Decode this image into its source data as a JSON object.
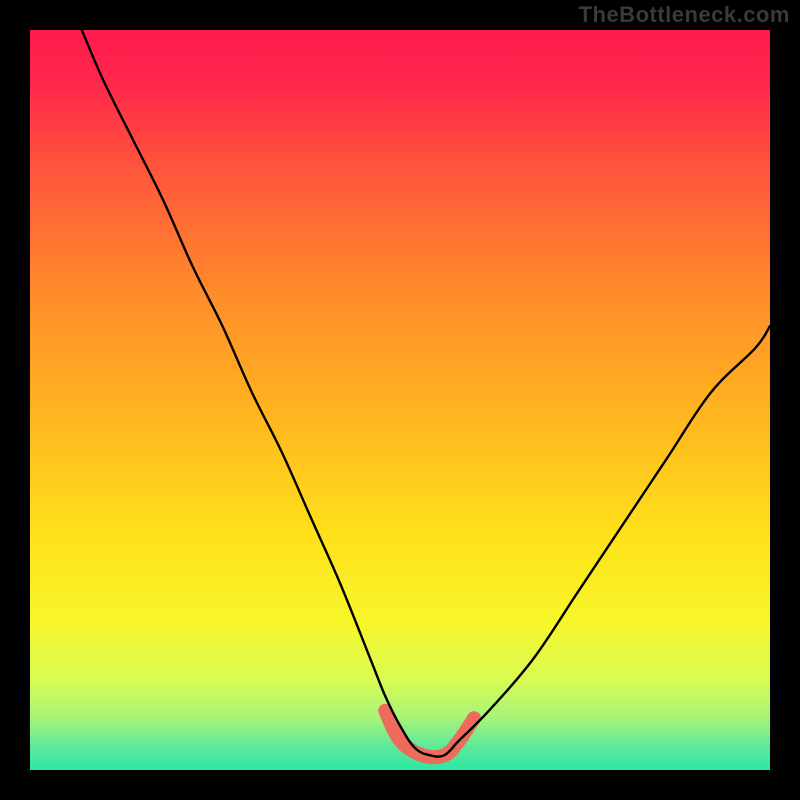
{
  "watermark": "TheBottleneck.com",
  "colors": {
    "frame": "#000000",
    "gradient_stops": [
      {
        "offset": 0.0,
        "color": "#ff1a4f"
      },
      {
        "offset": 0.08,
        "color": "#ff2a4a"
      },
      {
        "offset": 0.2,
        "color": "#ff5a3a"
      },
      {
        "offset": 0.35,
        "color": "#ff8a2a"
      },
      {
        "offset": 0.52,
        "color": "#ffb51f"
      },
      {
        "offset": 0.68,
        "color": "#ffe01a"
      },
      {
        "offset": 0.8,
        "color": "#f7f72a"
      },
      {
        "offset": 0.88,
        "color": "#d8fa55"
      },
      {
        "offset": 0.93,
        "color": "#a6f47a"
      },
      {
        "offset": 0.97,
        "color": "#5be89a"
      },
      {
        "offset": 1.0,
        "color": "#2de8a5"
      }
    ],
    "curve": "#000000",
    "accent": "#ee6a5b"
  },
  "chart_data": {
    "type": "line",
    "title": "",
    "xlabel": "",
    "ylabel": "",
    "xlim": [
      0,
      100
    ],
    "ylim": [
      0,
      100
    ],
    "grid": false,
    "legend": false,
    "series": [
      {
        "name": "curve",
        "x": [
          7,
          10,
          14,
          18,
          22,
          26,
          30,
          34,
          38,
          42,
          46,
          48,
          50,
          52,
          54,
          56,
          58,
          62,
          68,
          74,
          80,
          86,
          92,
          98,
          100
        ],
        "y": [
          100,
          93,
          85,
          77,
          68,
          60,
          51,
          43,
          34,
          25,
          15,
          10,
          6,
          3,
          2,
          2,
          4,
          8,
          15,
          24,
          33,
          42,
          51,
          57,
          60
        ]
      },
      {
        "name": "accent-flat-region",
        "x": [
          48,
          50,
          53,
          56,
          58,
          60
        ],
        "y": [
          8,
          4,
          2,
          2,
          4,
          7
        ]
      }
    ],
    "annotations": []
  }
}
